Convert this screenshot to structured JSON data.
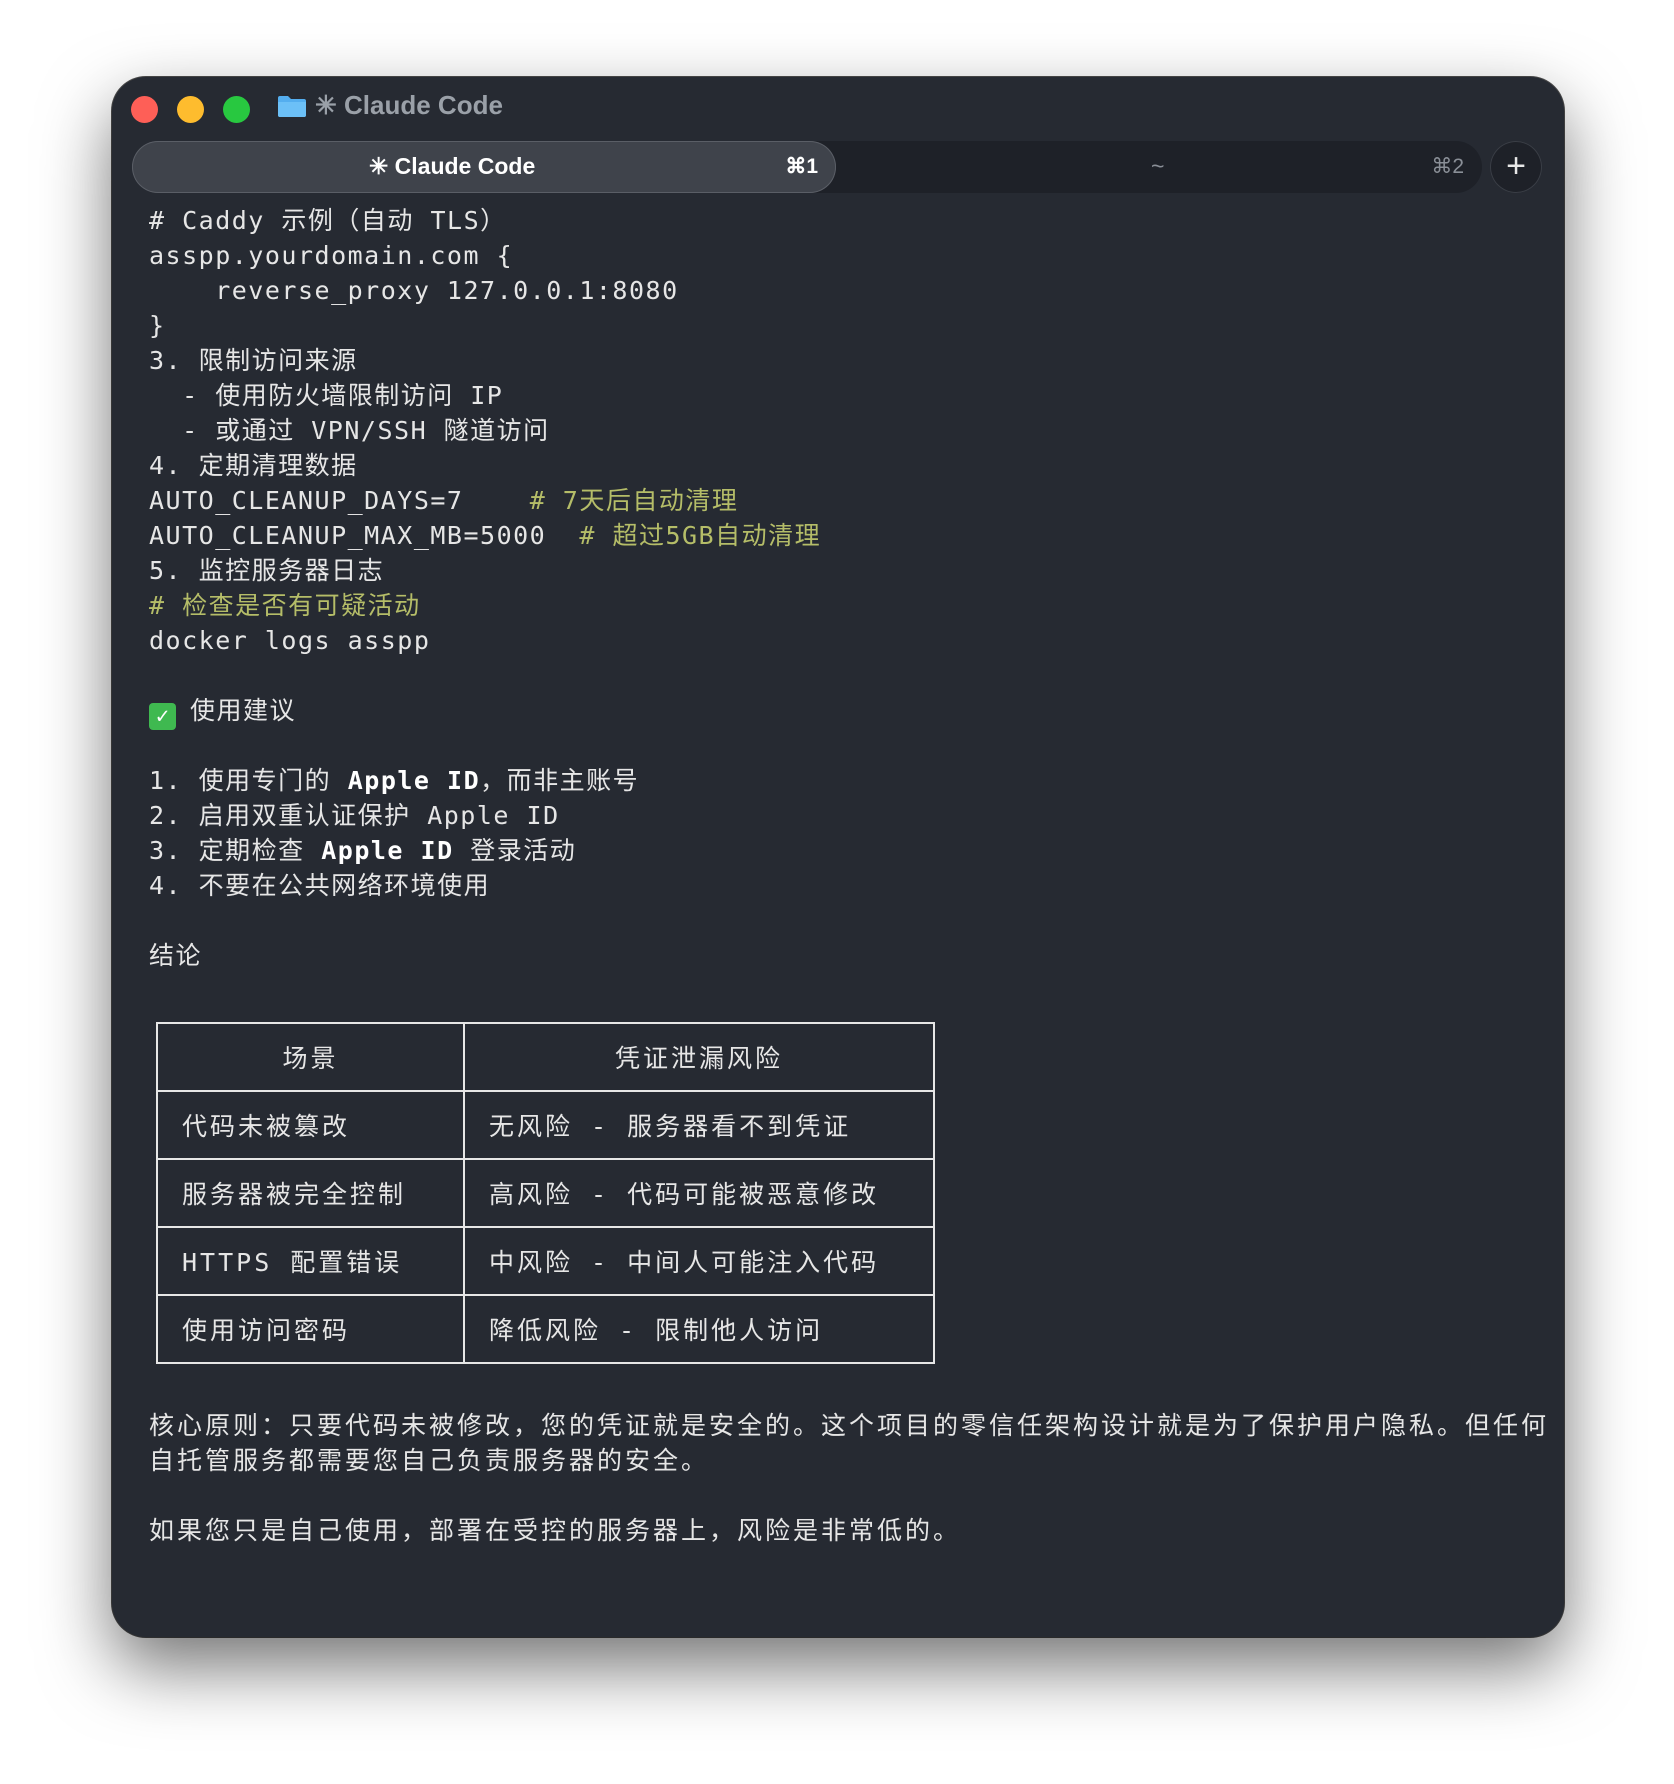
{
  "window": {
    "title": "✳ Claude Code"
  },
  "tabs": [
    {
      "label": "✳ Claude Code",
      "shortcut": "⌘1",
      "active": true
    },
    {
      "label": "~",
      "shortcut": "⌘2",
      "active": false
    }
  ],
  "new_tab_label": "+",
  "colors": {
    "background": "#262a32",
    "text": "#e6e6e6",
    "comment": "#b5bd68",
    "close": "#fe5f57",
    "minimize": "#febc2e",
    "zoom": "#28c840",
    "folder": "#54aeef",
    "check": "#3fb950"
  },
  "icons": {
    "folder": "folder-icon",
    "check": "check-mark-icon",
    "new_tab": "plus-icon"
  },
  "terminal": {
    "caddy_comment": "# Caddy 示例（自动 TLS）",
    "caddy_block_open": "asspp.yourdomain.com {",
    "caddy_proxy": "    reverse_proxy 127.0.0.1:8080",
    "caddy_block_close": "}",
    "item3_title": "3. 限制访问来源",
    "item3_sub1": "  - 使用防火墙限制访问 IP",
    "item3_sub2": "  - 或通过 VPN/SSH 隧道访问",
    "item4_title": "4. 定期清理数据",
    "cleanup_days_code": "AUTO_CLEANUP_DAYS=7    ",
    "cleanup_days_comment": "# 7天后自动清理",
    "cleanup_mb_code": "AUTO_CLEANUP_MAX_MB=5000  ",
    "cleanup_mb_comment": "# 超过5GB自动清理",
    "item5_title": "5. 监控服务器日志",
    "log_comment": "# 检查是否有可疑活动",
    "log_command": "docker logs asspp",
    "suggest_heading": "使用建议",
    "suggest1_prefix": "1. 使用专门的 ",
    "suggest1_bold": "Apple ID",
    "suggest1_suffix": "，而非主账号",
    "suggest2": "2. 启用双重认证保护 Apple ID",
    "suggest3_prefix": "3. 定期检查 ",
    "suggest3_bold": "Apple ID",
    "suggest3_suffix": " 登录活动",
    "suggest4": "4. 不要在公共网络环境使用",
    "conclusion_heading": "结论",
    "core_principle": "核心原则：只要代码未被修改，您的凭证就是安全的。这个项目的零信任架构设计就是为了保护用户隐私。但任何自托管服务都需要您自己负责服务器的安全。",
    "closing": "如果您只是自己使用，部署在受控的服务器上，风险是非常低的。"
  },
  "table": {
    "headers": [
      "场景",
      "凭证泄漏风险"
    ],
    "rows": [
      [
        "代码未被篡改",
        "无风险 - 服务器看不到凭证"
      ],
      [
        "服务器被完全控制",
        "高风险 - 代码可能被恶意修改"
      ],
      [
        "HTTPS 配置错误",
        "中风险 - 中间人可能注入代码"
      ],
      [
        "使用访问密码",
        "降低风险 - 限制他人访问"
      ]
    ]
  }
}
